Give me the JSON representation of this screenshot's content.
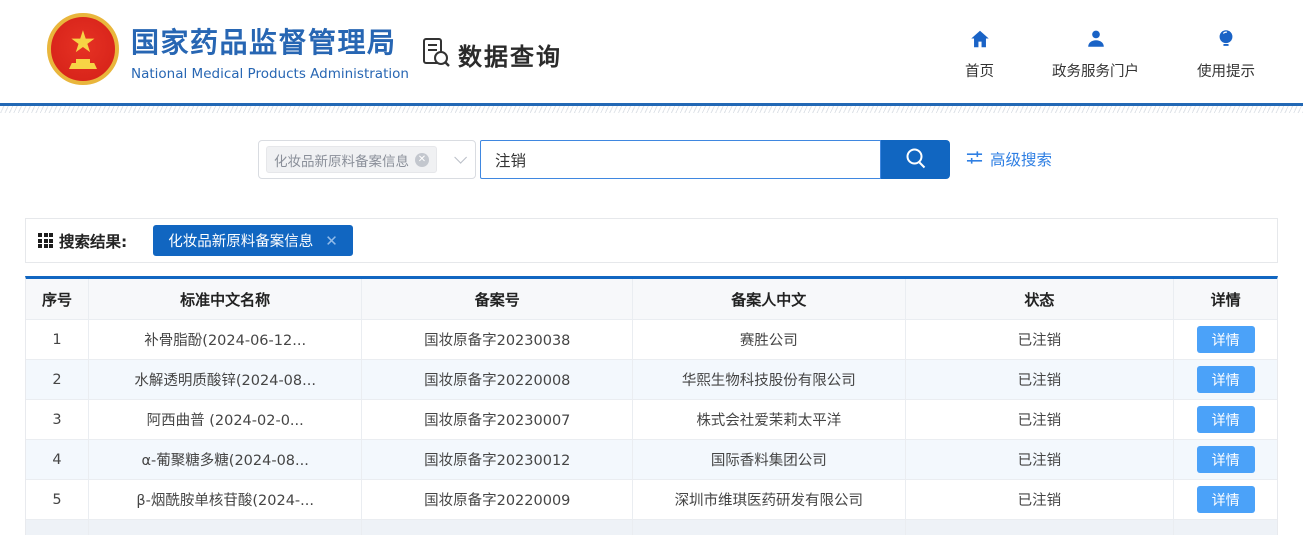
{
  "header": {
    "org_name_cn": "国家药品监督管理局",
    "org_name_en": "National Medical Products Administration",
    "app_title": "数据查询",
    "nav": [
      {
        "label": "首页"
      },
      {
        "label": "政务服务门户"
      },
      {
        "label": "使用提示"
      }
    ]
  },
  "search": {
    "category_tag": "化妆品新原料备案信息",
    "query": "注销",
    "advanced_label": "高级搜索"
  },
  "results": {
    "label": "搜索结果:",
    "filter_tag": "化妆品新原料备案信息"
  },
  "table": {
    "columns": [
      "序号",
      "标准中文名称",
      "备案号",
      "备案人中文",
      "状态",
      "详情"
    ],
    "detail_label": "详情",
    "rows": [
      {
        "no": "1",
        "name": "补骨脂酚(2024-06-12...",
        "reg_no": "国妆原备字20230038",
        "registrant": "赛胜公司",
        "status": "已注销"
      },
      {
        "no": "2",
        "name": "水解透明质酸锌(2024-08...",
        "reg_no": "国妆原备字20220008",
        "registrant": "华熙生物科技股份有限公司",
        "status": "已注销"
      },
      {
        "no": "3",
        "name": "阿西曲普 (2024-02-0...",
        "reg_no": "国妆原备字20230007",
        "registrant": "株式会社爱茉莉太平洋",
        "status": "已注销"
      },
      {
        "no": "4",
        "name": "α-葡聚糖多糖(2024-08...",
        "reg_no": "国妆原备字20230012",
        "registrant": "国际香料集团公司",
        "status": "已注销"
      },
      {
        "no": "5",
        "name": "β-烟酰胺单核苷酸(2024-...",
        "reg_no": "国妆原备字20220009",
        "registrant": "深圳市维琪医药研发有限公司",
        "status": "已注销"
      }
    ]
  },
  "colors": {
    "accent": "#1166c1",
    "accent-light": "#4ba2f9",
    "link": "#2f7fe3",
    "brand-blue": "#2766b3",
    "divider-blue": "#2268b5",
    "nav-icon-blue": "#1a63c6"
  }
}
